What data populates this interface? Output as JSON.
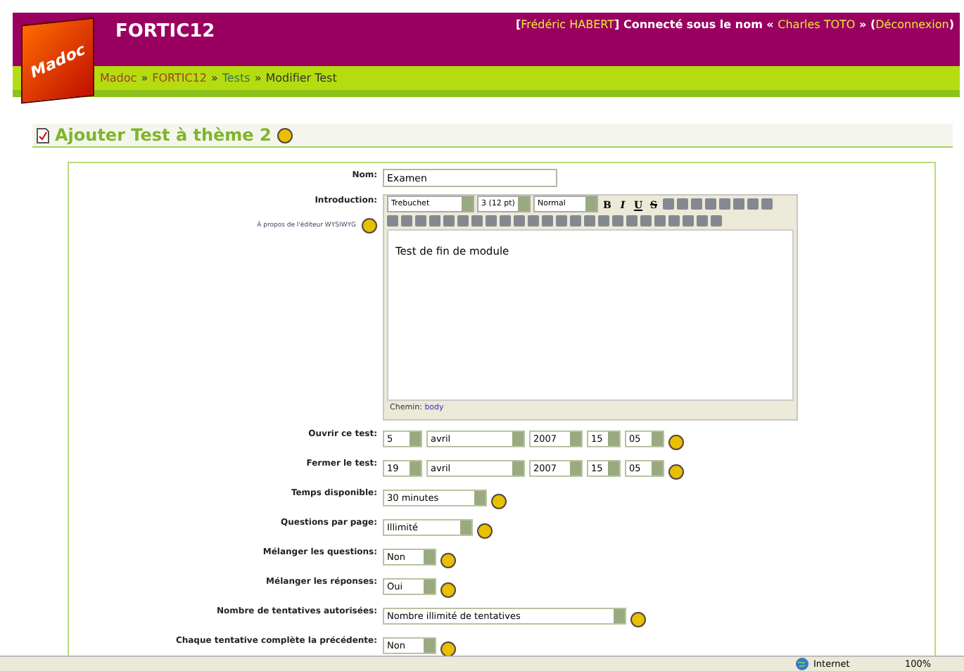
{
  "header": {
    "logo": "Madoc",
    "site_title": "FORTIC12",
    "user": {
      "open": "[",
      "name": "Frédéric HABERT",
      "connected_as": "] Connecté sous le nom «",
      "login_name": "Charles TOTO",
      "after": "» (",
      "logout": "Déconnexion",
      "close": ")"
    },
    "breadcrumb": [
      {
        "label": "Madoc",
        "link": true
      },
      {
        "label": "FORTIC12",
        "link": true
      },
      {
        "label": "Tests",
        "link": true
      },
      {
        "label": "Modifier Test",
        "link": false
      }
    ],
    "separator": "»"
  },
  "heading": "Ajouter Test à thème 2",
  "form": {
    "name": {
      "label": "Nom:",
      "value": "Examen"
    },
    "introduction": {
      "label": "Introduction:",
      "about_link": "À propos de l'éditeur WYSIWYG",
      "toolbar_selects": [
        {
          "value": "Trebuchet"
        },
        {
          "value": "3 (12 pt)"
        },
        {
          "value": "Normal"
        }
      ],
      "format_buttons": [
        "B",
        "I",
        "U",
        "S"
      ],
      "content": "Test de fin de module",
      "path_label": "Chemin:",
      "path_value": "body"
    },
    "rows": [
      {
        "kind": "date",
        "label": "Ouvrir ce test:",
        "selects": [
          "5",
          "avril",
          "2007",
          "15",
          "05"
        ]
      },
      {
        "kind": "date",
        "label": "Fermer le test:",
        "selects": [
          "19",
          "avril",
          "2007",
          "15",
          "05"
        ]
      },
      {
        "kind": "select",
        "label": "Temps disponible:",
        "selects": [
          "30 minutes"
        ]
      },
      {
        "kind": "select",
        "label": "Questions par page:",
        "selects": [
          "Illimité"
        ]
      },
      {
        "kind": "select",
        "label": "Mélanger les questions:",
        "selects": [
          "Non"
        ]
      },
      {
        "kind": "select",
        "label": "Mélanger les réponses:",
        "selects": [
          "Oui"
        ]
      },
      {
        "kind": "select",
        "label": "Nombre de tentatives autorisées:",
        "selects": [
          "Nombre illimité de tentatives"
        ]
      },
      {
        "kind": "select",
        "label": "Chaque tentative complète la précédente:",
        "selects": [
          "Non"
        ]
      }
    ]
  },
  "status_bar": {
    "zone": "Internet",
    "zoom": "100%"
  }
}
